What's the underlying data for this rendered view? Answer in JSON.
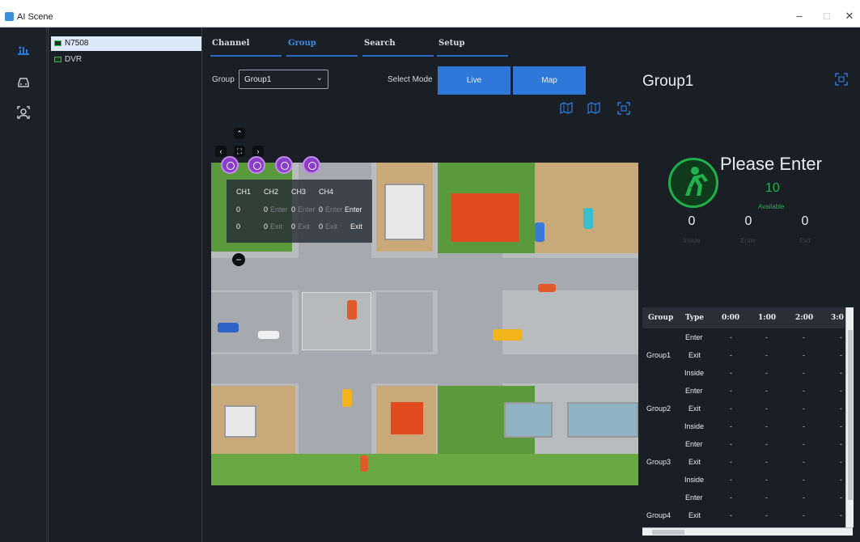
{
  "window": {
    "title": "AI Scene",
    "minimize": "–",
    "maximize": "□",
    "close": "✕"
  },
  "devices": [
    {
      "label": "N7508",
      "selected": true
    },
    {
      "label": "DVR",
      "selected": false
    }
  ],
  "tabs": [
    {
      "label": "Channel"
    },
    {
      "label": "Group",
      "active": true
    },
    {
      "label": "Search"
    },
    {
      "label": "Setup"
    }
  ],
  "group": {
    "label": "Group",
    "selected": "Group1"
  },
  "mode": {
    "label": "Select Mode",
    "live": "Live",
    "map": "Map"
  },
  "group_title": "Group1",
  "map_overlay": {
    "channels": [
      "CH1",
      "CH2",
      "CH3",
      "CH4"
    ],
    "enter_values": [
      "0",
      "0",
      "0",
      "0"
    ],
    "exit_values": [
      "0",
      "0",
      "0",
      "0"
    ],
    "enter_word": "Enter",
    "exit_word": "Exit",
    "enter_label": "Enter",
    "exit_label": "Exit"
  },
  "status": {
    "message": "Please Enter",
    "available": "10",
    "available_label": "Available",
    "inside": "0",
    "inside_label": "Inside",
    "enter": "0",
    "enter_label": "Enter",
    "exit": "0",
    "exit_label": "Exit"
  },
  "stats_table": {
    "headers": [
      "Group",
      "Type",
      "0:00",
      "1:00",
      "2:00",
      "3:0"
    ],
    "rows": [
      {
        "group": "",
        "type": "Enter"
      },
      {
        "group": "Group1",
        "type": "Exit"
      },
      {
        "group": "",
        "type": "Inside"
      },
      {
        "group": "",
        "type": "Enter"
      },
      {
        "group": "Group2",
        "type": "Exit"
      },
      {
        "group": "",
        "type": "Inside"
      },
      {
        "group": "",
        "type": "Enter"
      },
      {
        "group": "Group3",
        "type": "Exit"
      },
      {
        "group": "",
        "type": "Inside"
      },
      {
        "group": "",
        "type": "Enter"
      },
      {
        "group": "Group4",
        "type": "Exit"
      }
    ],
    "empty_value": "-"
  },
  "colors": {
    "accent": "#2f78d9",
    "status_green": "#21b24c",
    "panel_bg": "#1a1e25"
  }
}
